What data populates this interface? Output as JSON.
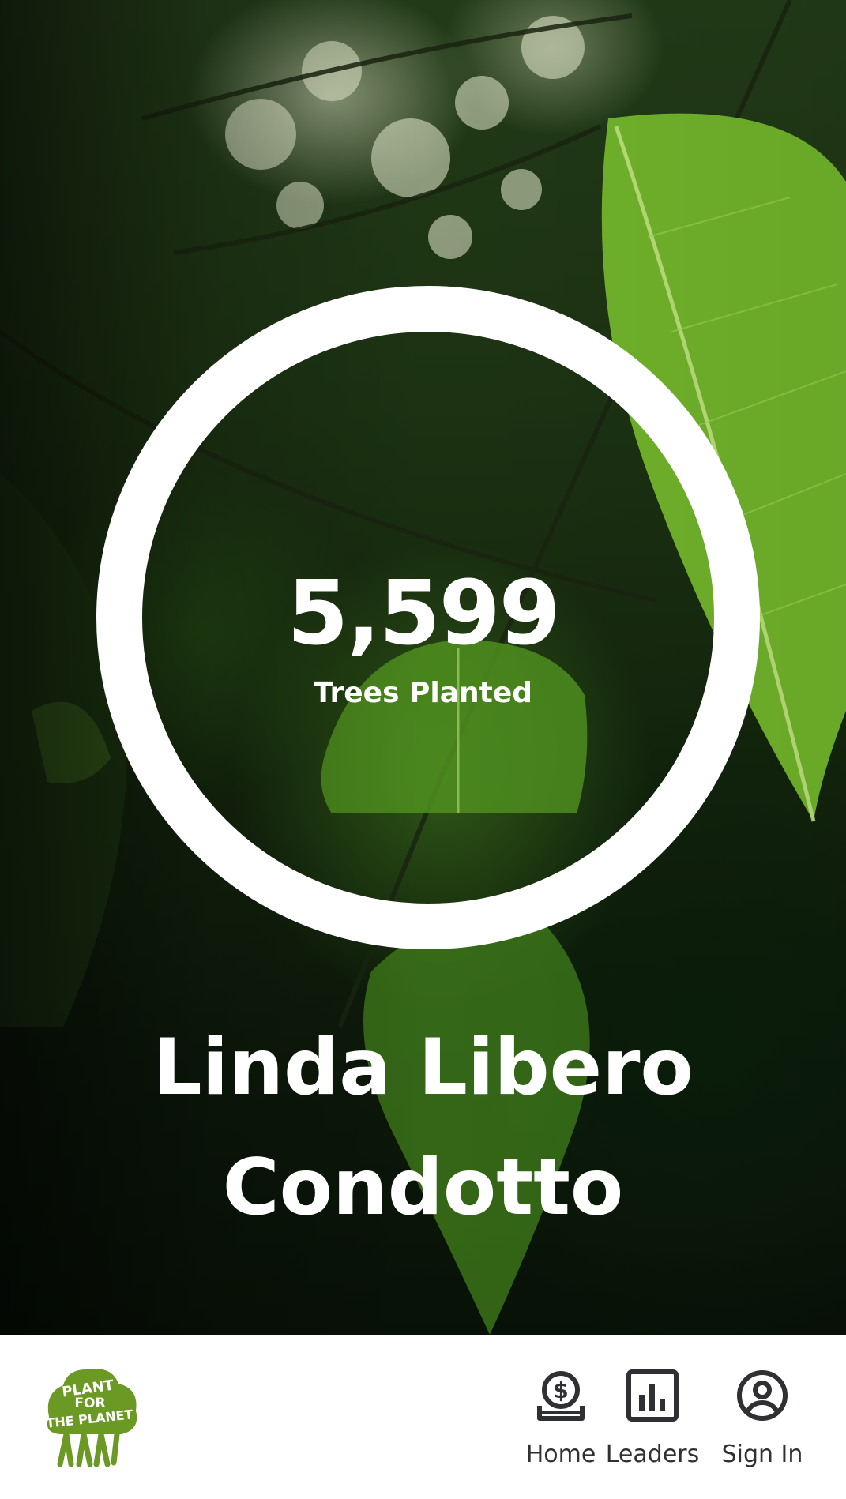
{
  "profile": {
    "tree_count": "5,599",
    "tree_label": "Trees Planted",
    "name": "Linda Libero Condotto"
  },
  "nav": {
    "home": {
      "label": "Home",
      "icon": "donate-icon"
    },
    "leaders": {
      "label": "Leaders",
      "icon": "leaderboard-icon"
    },
    "signin": {
      "label": "Sign In",
      "icon": "user-icon"
    }
  },
  "logo": {
    "line1": "PLANT",
    "line2": "FOR",
    "line3": "THE PLANET",
    "color": "#6a9a23"
  },
  "colors": {
    "ring": "#ffffff",
    "nav_icon": "#2f3033",
    "bar_background": "#ffffff"
  }
}
